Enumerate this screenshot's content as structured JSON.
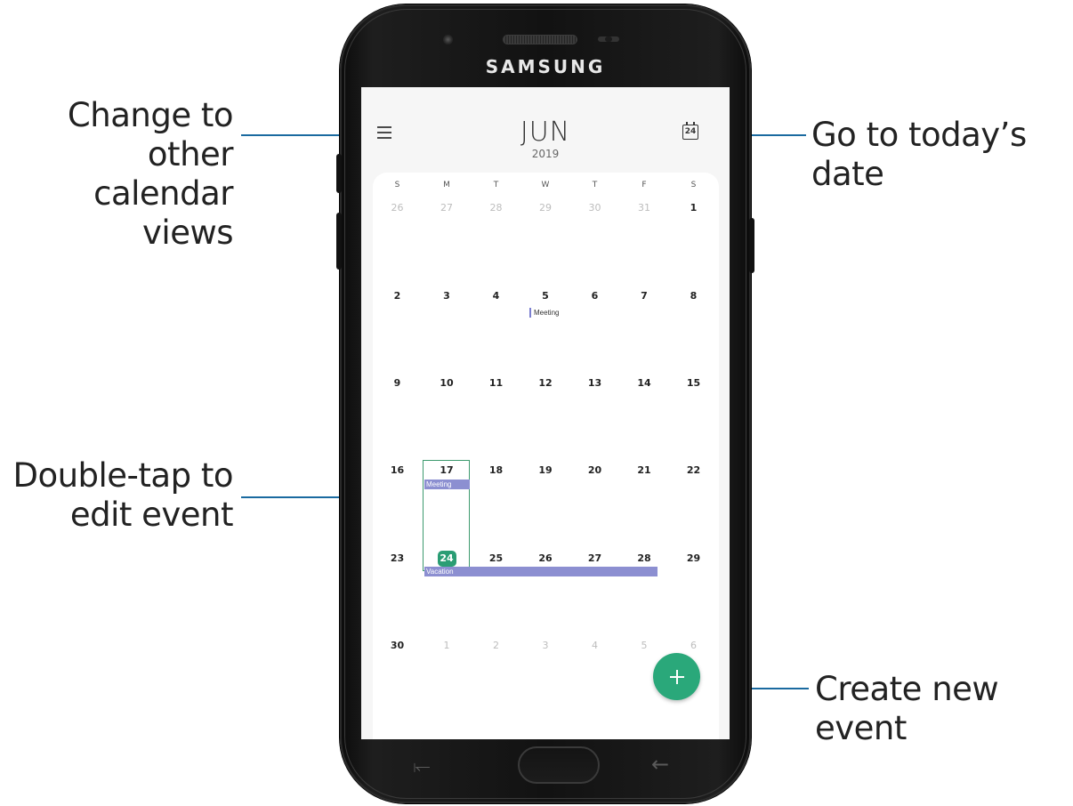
{
  "annotations": {
    "change_views_line1": "Change to other",
    "change_views_line2": "calendar views",
    "double_tap_line1": "Double-tap to",
    "double_tap_line2": "edit event",
    "today": "Go to today’s date",
    "create": "Create new event"
  },
  "device": {
    "brand": "SAMSUNG"
  },
  "header": {
    "month": "JUN",
    "year": "2019",
    "today_icon_day": "24"
  },
  "weekdays": [
    "S",
    "M",
    "T",
    "W",
    "T",
    "F",
    "S"
  ],
  "weeks": [
    [
      "26",
      "27",
      "28",
      "29",
      "30",
      "31",
      "1"
    ],
    [
      "2",
      "3",
      "4",
      "5",
      "6",
      "7",
      "8"
    ],
    [
      "9",
      "10",
      "11",
      "12",
      "13",
      "14",
      "15"
    ],
    [
      "16",
      "17",
      "18",
      "19",
      "20",
      "21",
      "22"
    ],
    [
      "23",
      "24",
      "25",
      "26",
      "27",
      "28",
      "29"
    ],
    [
      "30",
      "1",
      "2",
      "3",
      "4",
      "5",
      "6"
    ]
  ],
  "events": {
    "meeting_5": "Meeting",
    "meeting_17": "Meeting",
    "vacation": "Vacation"
  },
  "today": "24",
  "colors": {
    "accent": "#2aa87a",
    "event": "#8c8fd1",
    "today_badge": "#2a9d74"
  }
}
